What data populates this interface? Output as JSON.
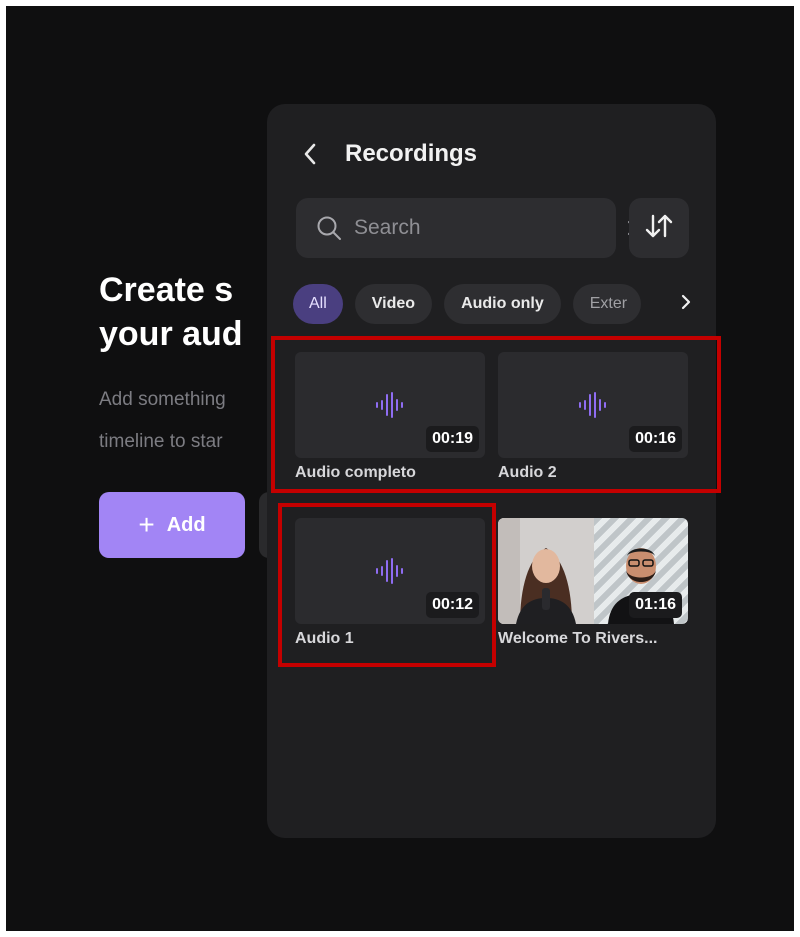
{
  "background": {
    "heading_line1": "Create s",
    "heading_line2": "your aud",
    "sub_line1": "Add something",
    "sub_line2": "timeline to star",
    "add_button_label": "Add"
  },
  "panel": {
    "title": "Recordings",
    "search": {
      "placeholder": "Search",
      "value": ""
    },
    "filters": [
      {
        "label": "All",
        "active": true
      },
      {
        "label": "Video",
        "active": false
      },
      {
        "label": "Audio only",
        "active": false
      },
      {
        "label": "Exter",
        "active": false
      }
    ],
    "recordings": [
      {
        "name": "Audio completo",
        "duration": "00:19",
        "type": "audio"
      },
      {
        "name": "Audio 2",
        "duration": "00:16",
        "type": "audio"
      },
      {
        "name": "Audio 1",
        "duration": "00:12",
        "type": "audio"
      },
      {
        "name": "Welcome To Rivers...",
        "duration": "01:16",
        "type": "video"
      }
    ]
  },
  "colors": {
    "accent": "#a285f5",
    "waveform": "#8f6df2",
    "active_chip_bg": "#4a3f80",
    "highlight_box": "#c40000"
  },
  "icons": [
    "back-chevron-icon",
    "search-icon",
    "clear-icon",
    "sort-icon",
    "chevron-right-icon",
    "waveform-icon",
    "plus-icon"
  ]
}
